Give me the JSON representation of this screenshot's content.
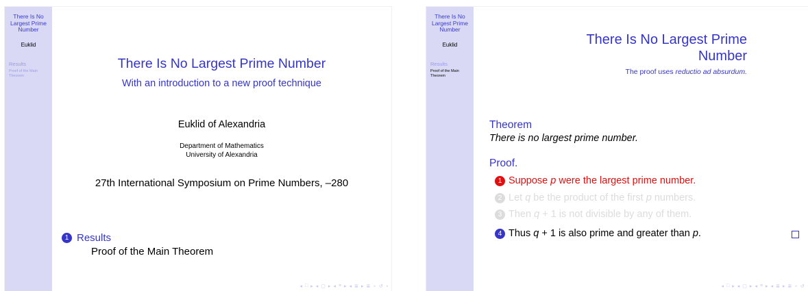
{
  "slide1": {
    "sidebar": {
      "title_line1": "There Is No",
      "title_line2": "Largest Prime",
      "title_line3": "Number",
      "author": "Euklid",
      "section": "Results",
      "subsection_line1": "Proof of the Main",
      "subsection_line2": "Theorem"
    },
    "title": "There Is No Largest Prime Number",
    "subtitle": "With an introduction to a new proof technique",
    "author": "Euklid of Alexandria",
    "institute_line1": "Department of Mathematics",
    "institute_line2": "University of Alexandria",
    "date": "27th International Symposium on Prime Numbers, –280",
    "toc": {
      "number": "1",
      "section": "Results",
      "subsection": "Proof of the Main Theorem"
    }
  },
  "slide2": {
    "sidebar": {
      "title_line1": "There Is No",
      "title_line2": "Largest Prime",
      "title_line3": "Number",
      "author": "Euklid",
      "section": "Results",
      "subsection_line1": "Proof of the Main",
      "subsection_line2": "Theorem"
    },
    "title_line1": "There Is No Largest Prime",
    "title_line2": "Number",
    "subtitle_prefix": "The proof uses ",
    "subtitle_italic": "reductio ad absurdum.",
    "theorem_label": "Theorem",
    "theorem_text": "There is no largest prime number.",
    "proof_label": "Proof.",
    "steps": [
      {
        "number": "1",
        "parts": [
          "Suppose ",
          "p",
          " were the largest prime number."
        ]
      },
      {
        "number": "2",
        "parts": [
          "Let ",
          "q",
          " be the product of the first ",
          "p",
          " numbers."
        ]
      },
      {
        "number": "3",
        "parts": [
          "Then ",
          "q",
          " + 1 is not divisible by any of them."
        ]
      },
      {
        "number": "4",
        "parts": [
          "Thus ",
          "q",
          " + 1 is also prime and greater than ",
          "p",
          "."
        ]
      }
    ]
  },
  "navigation": [
    "◂",
    "□",
    "▸",
    "◂",
    "▢",
    "▸",
    "◂",
    "≡",
    "▸",
    "◂",
    "≣",
    "▸",
    "≣",
    "∘",
    "↺",
    "∘"
  ],
  "colors": {
    "structure": "#3535c8",
    "sidebar": "#d9d9f5",
    "alert": "#e01010",
    "faded": "#dcdcdc"
  }
}
